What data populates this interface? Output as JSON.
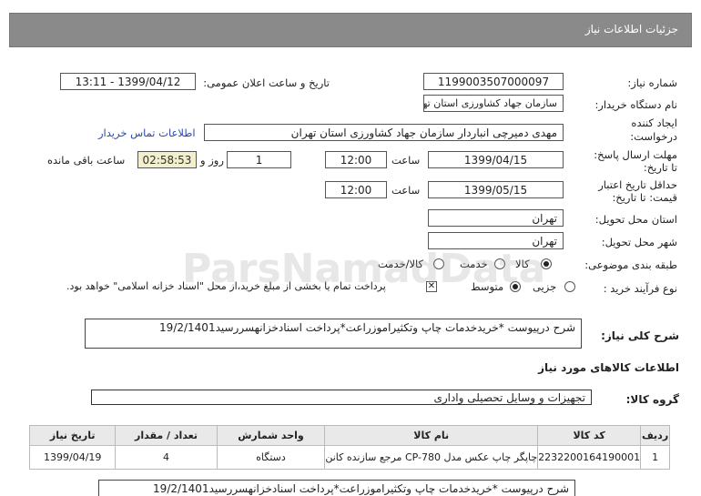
{
  "header": {
    "title": "جزئیات اطلاعات نیاز"
  },
  "form": {
    "need_number_label": "شماره نیاز:",
    "need_number": "1199003507000097",
    "announce_label": "تاریخ و ساعت اعلان عمومی:",
    "announce_value": "1399/04/12 - 13:11",
    "buyer_label": "نام دستگاه خریدار:",
    "buyer_value": "سازمان جهاد کشاورزی استان تهران",
    "creator_label_1": "ایجاد کننده",
    "creator_label_2": "درخواست:",
    "creator_value": "مهدی  دمیرچی انباردار سازمان جهاد کشاورزی استان تهران",
    "contact_link": "اطلاعات تماس خریدار",
    "deadline_label_1": "مهلت ارسال پاسخ:",
    "deadline_label_2": "تا تاریخ:",
    "deadline_date": "1399/04/15",
    "time_label": "ساعت",
    "deadline_time": "12:00",
    "days_value": "1",
    "days_label": "روز و",
    "remaining_time": "02:58:53",
    "remaining_label": "ساعت باقی مانده",
    "validity_label_1": "حداقل تاریخ اعتبار",
    "validity_label_2": "قیمت: تا تاریخ:",
    "validity_date": "1399/05/15",
    "validity_time_label": "ساعت",
    "validity_time": "12:00",
    "province_label": "استان محل تحویل:",
    "province_value": "تهران",
    "city_label": "شهر محل تحویل:",
    "city_value": "تهران",
    "category_label": "طبقه بندی موضوعی:",
    "category_options": [
      "کالا",
      "خدمت",
      "کالا/خدمت"
    ],
    "purchase_label": "نوع فرآیند خرید :",
    "purchase_options": [
      "جزیی",
      "متوسط"
    ],
    "payment_note": "پرداخت تمام یا بخشی از مبلغ خرید،از محل \"اسناد خزانه اسلامی\" خواهد بود."
  },
  "summary": {
    "label": "شرح کلی نیاز:",
    "value": "شرح درپیوست *خریدخدمات  چاپ وتکثیراموزراعت*پرداخت اسنادخزانهسررسید19/2/1401"
  },
  "goods": {
    "section_title": "اطلاعات کالاهای مورد نیاز",
    "group_label": "گروه کالا:",
    "group_value": "تجهیزات و وسایل تحصیلی واداری",
    "columns": [
      "ردیف",
      "کد کالا",
      "نام کالا",
      "واحد شمارش",
      "تعداد / مقدار",
      "تاریخ نیاز"
    ],
    "rows": [
      [
        "1",
        "2232200164190001",
        "چاپگر چاپ عکس مدل CP-780 مرجع سازنده کانن",
        "دستگاه",
        "4",
        "1399/04/19"
      ]
    ],
    "bottom_note": "شرح درپیوست *خریدخدمات  چاپ وتکثیراموزراعت*پرداخت اسنادخزانهسررسید19/2/1401"
  },
  "watermark": "ParsNamadData"
}
